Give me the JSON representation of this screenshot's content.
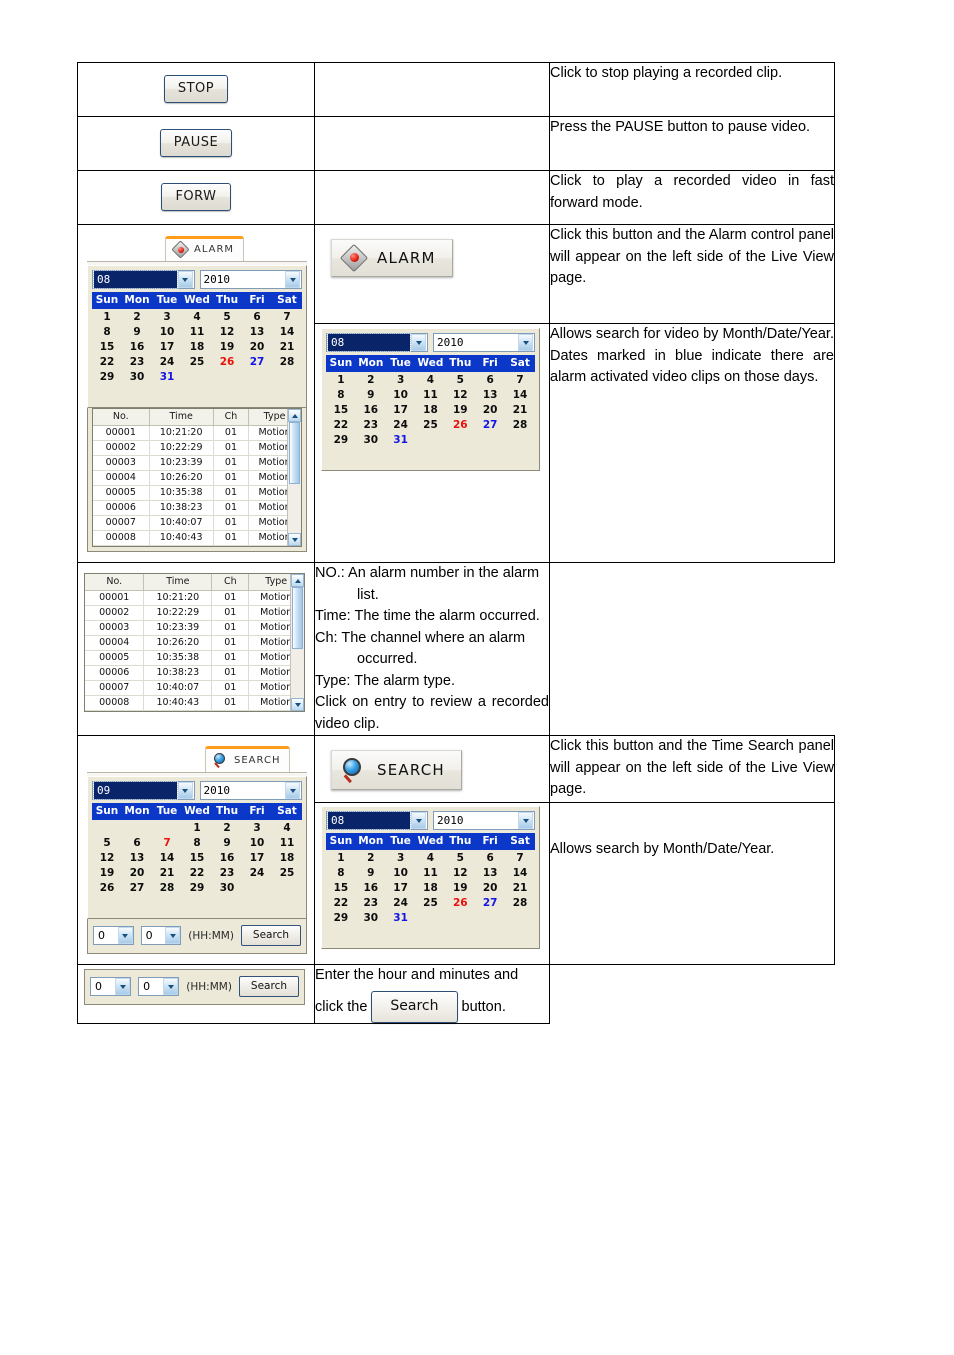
{
  "rows": {
    "stop": {
      "button_label": "STOP",
      "description": "Click to stop playing a recorded clip."
    },
    "pause": {
      "button_label": "PAUSE",
      "description": "Press the PAUSE button to pause video."
    },
    "forward": {
      "button_label": "FORW",
      "description": "Click to play a recorded video in fast forward mode."
    },
    "alarm_button": {
      "button_label": "ALARM",
      "tab_label": "ALARM",
      "icon": "alarm-diamond-icon",
      "description": "Click this button and the Alarm control panel will appear on the left side of the Live View page."
    },
    "alarm_calendar": {
      "description_line1": "Allows search for video by Month/Date/Year.",
      "description_line2": "Dates marked in blue indicate there are alarm activated video clips on those days."
    },
    "alarm_list": {
      "desc_no": "NO.: An alarm number in the alarm",
      "desc_no_cont": "list.",
      "desc_time": "Time: The time the alarm occurred.",
      "desc_ch": "Ch: The channel where an alarm",
      "desc_ch_cont": "occurred.",
      "desc_type": "Type: The alarm type.",
      "desc_click": "Click on entry to review a recorded video clip."
    },
    "search_button": {
      "button_label": "SEARCH",
      "tab_label": "SEARCH",
      "icon": "magnifier-icon",
      "description": "Click this button and the Time Search panel will appear on the left side of the Live View page."
    },
    "search_calendar": {
      "description": "Allows search by Month/Date/Year."
    },
    "time_search": {
      "desc_part1": "Enter the hour and minutes and",
      "desc_part2": "click the",
      "inline_button_label": "Search",
      "desc_part3": "button."
    }
  },
  "calendar_august": {
    "month": "08",
    "year": "2010",
    "weekdays": [
      "Sun",
      "Mon",
      "Tue",
      "Wed",
      "Thu",
      "Fri",
      "Sat"
    ],
    "weeks": [
      [
        {
          "d": "1"
        },
        {
          "d": "2"
        },
        {
          "d": "3"
        },
        {
          "d": "4"
        },
        {
          "d": "5"
        },
        {
          "d": "6"
        },
        {
          "d": "7"
        }
      ],
      [
        {
          "d": "8"
        },
        {
          "d": "9"
        },
        {
          "d": "10"
        },
        {
          "d": "11"
        },
        {
          "d": "12"
        },
        {
          "d": "13"
        },
        {
          "d": "14"
        }
      ],
      [
        {
          "d": "15"
        },
        {
          "d": "16"
        },
        {
          "d": "17"
        },
        {
          "d": "18"
        },
        {
          "d": "19"
        },
        {
          "d": "20"
        },
        {
          "d": "21"
        }
      ],
      [
        {
          "d": "22"
        },
        {
          "d": "23"
        },
        {
          "d": "24"
        },
        {
          "d": "25"
        },
        {
          "d": "26",
          "c": "red"
        },
        {
          "d": "27",
          "c": "blue"
        },
        {
          "d": "28"
        }
      ],
      [
        {
          "d": "29"
        },
        {
          "d": "30"
        },
        {
          "d": "31",
          "c": "blue"
        },
        {
          "d": ""
        },
        {
          "d": ""
        },
        {
          "d": ""
        },
        {
          "d": ""
        }
      ]
    ]
  },
  "calendar_september": {
    "month": "09",
    "year": "2010",
    "weekdays": [
      "Sun",
      "Mon",
      "Tue",
      "Wed",
      "Thu",
      "Fri",
      "Sat"
    ],
    "weeks": [
      [
        {
          "d": ""
        },
        {
          "d": ""
        },
        {
          "d": ""
        },
        {
          "d": "1"
        },
        {
          "d": "2"
        },
        {
          "d": "3"
        },
        {
          "d": "4"
        }
      ],
      [
        {
          "d": "5"
        },
        {
          "d": "6"
        },
        {
          "d": "7",
          "c": "red"
        },
        {
          "d": "8"
        },
        {
          "d": "9"
        },
        {
          "d": "10"
        },
        {
          "d": "11"
        }
      ],
      [
        {
          "d": "12"
        },
        {
          "d": "13"
        },
        {
          "d": "14"
        },
        {
          "d": "15"
        },
        {
          "d": "16"
        },
        {
          "d": "17"
        },
        {
          "d": "18"
        }
      ],
      [
        {
          "d": "19"
        },
        {
          "d": "20"
        },
        {
          "d": "21"
        },
        {
          "d": "22"
        },
        {
          "d": "23"
        },
        {
          "d": "24"
        },
        {
          "d": "25"
        }
      ],
      [
        {
          "d": "26"
        },
        {
          "d": "27"
        },
        {
          "d": "28"
        },
        {
          "d": "29"
        },
        {
          "d": "30"
        },
        {
          "d": ""
        },
        {
          "d": ""
        }
      ]
    ]
  },
  "alarm_list_grid": {
    "headers": [
      "No.",
      "Time",
      "Ch",
      "Type"
    ],
    "rows": [
      [
        "00001",
        "10:21:20",
        "01",
        "Motion"
      ],
      [
        "00002",
        "10:22:29",
        "01",
        "Motion"
      ],
      [
        "00003",
        "10:23:39",
        "01",
        "Motion"
      ],
      [
        "00004",
        "10:26:20",
        "01",
        "Motion"
      ],
      [
        "00005",
        "10:35:38",
        "01",
        "Motion"
      ],
      [
        "00006",
        "10:38:23",
        "01",
        "Motion"
      ],
      [
        "00007",
        "10:40:07",
        "01",
        "Motion"
      ],
      [
        "00008",
        "10:40:43",
        "01",
        "Motion"
      ]
    ]
  },
  "time_search_controls": {
    "hour_value": "0",
    "minute_value": "0",
    "format_label": "(HH:MM)",
    "search_label": "Search"
  }
}
